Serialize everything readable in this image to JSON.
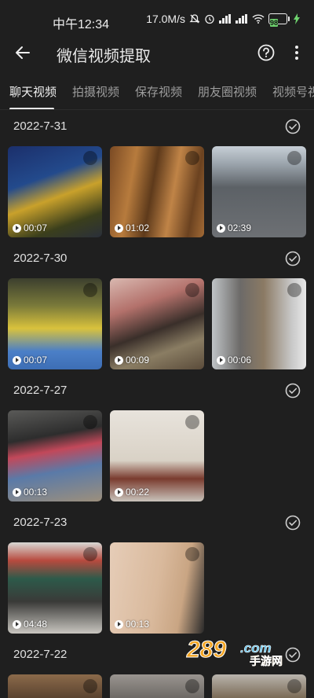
{
  "status": {
    "time": "中午12:34",
    "network_speed": "17.0M/s",
    "battery": "98"
  },
  "app_bar": {
    "title": "微信视频提取",
    "back_icon": "arrow-left-icon",
    "help_icon": "question-circle-icon",
    "more_icon": "more-vertical-icon"
  },
  "tabs": [
    {
      "label": "聊天视频",
      "active": true
    },
    {
      "label": "拍摄视频",
      "active": false
    },
    {
      "label": "保存视频",
      "active": false
    },
    {
      "label": "朋友圈视频",
      "active": false
    },
    {
      "label": "视频号视",
      "active": false
    }
  ],
  "groups": [
    {
      "date": "2022-7-31",
      "videos": [
        {
          "duration": "00:07"
        },
        {
          "duration": "01:02"
        },
        {
          "duration": "02:39"
        }
      ]
    },
    {
      "date": "2022-7-30",
      "videos": [
        {
          "duration": "00:07"
        },
        {
          "duration": "00:09"
        },
        {
          "duration": "00:06"
        }
      ]
    },
    {
      "date": "2022-7-27",
      "videos": [
        {
          "duration": "00:13"
        },
        {
          "duration": "00:22"
        }
      ]
    },
    {
      "date": "2022-7-23",
      "videos": [
        {
          "duration": "04:48"
        },
        {
          "duration": "00:13"
        }
      ]
    },
    {
      "date": "2022-7-22",
      "videos": [
        {
          "duration": ""
        },
        {
          "duration": ""
        },
        {
          "duration": ""
        }
      ]
    }
  ],
  "watermark": {
    "number": "289",
    "domain": ".com",
    "brand": "手游网"
  },
  "colors": {
    "background": "#1f1f1f",
    "text": "#e6e6e6",
    "tab_inactive": "#9c9c9c",
    "battery": "#6ed36e"
  }
}
